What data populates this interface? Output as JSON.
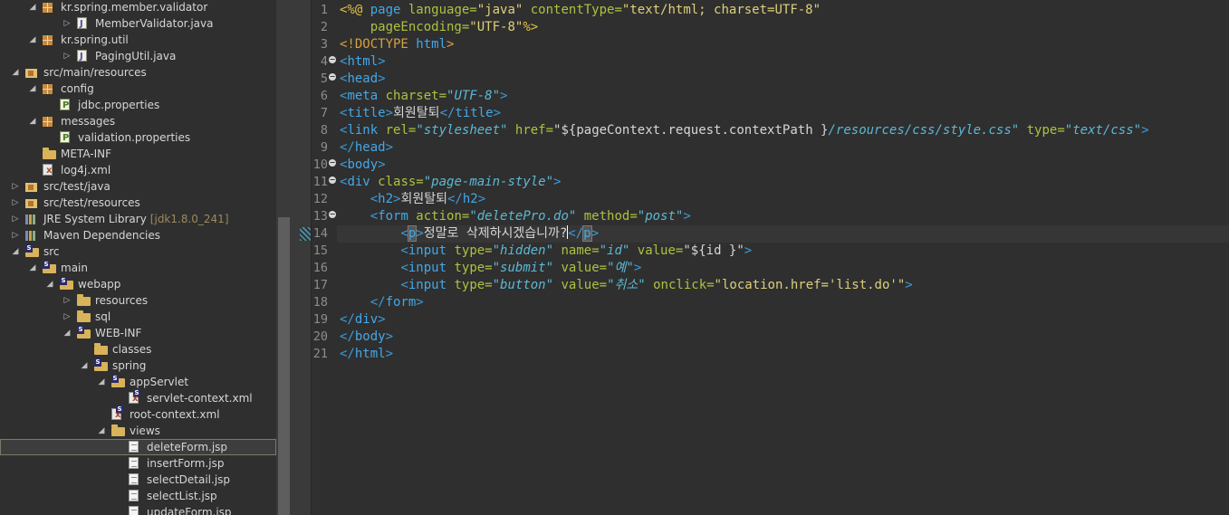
{
  "explorer": {
    "items": [
      {
        "label": "kr.spring.member.validator",
        "icon": "package-icon",
        "twisty": "open"
      },
      {
        "label": "MemberValidator.java",
        "icon": "java-file-icon",
        "twisty": "closed"
      },
      {
        "label": "kr.spring.util",
        "icon": "package-icon",
        "twisty": "open"
      },
      {
        "label": "PagingUtil.java",
        "icon": "java-file-icon",
        "twisty": "closed"
      },
      {
        "label": "src/main/resources",
        "icon": "source-folder-icon",
        "twisty": "open"
      },
      {
        "label": "config",
        "icon": "package-icon",
        "twisty": "open"
      },
      {
        "label": "jdbc.properties",
        "icon": "properties-file-icon",
        "twisty": ""
      },
      {
        "label": "messages",
        "icon": "package-icon",
        "twisty": "open"
      },
      {
        "label": "validation.properties",
        "icon": "properties-file-icon",
        "twisty": ""
      },
      {
        "label": "META-INF",
        "icon": "folder-icon",
        "twisty": ""
      },
      {
        "label": "log4j.xml",
        "icon": "xml-file-icon",
        "twisty": ""
      },
      {
        "label": "src/test/java",
        "icon": "source-folder-icon",
        "twisty": "closed"
      },
      {
        "label": "src/test/resources",
        "icon": "source-folder-icon",
        "twisty": "closed"
      },
      {
        "label": "JRE System Library",
        "decor": "[jdk1.8.0_241]",
        "icon": "library-icon",
        "twisty": "closed"
      },
      {
        "label": "Maven Dependencies",
        "icon": "library-icon",
        "twisty": "closed"
      },
      {
        "label": "src",
        "icon": "folder-icon",
        "twisty": "open"
      },
      {
        "label": "main",
        "icon": "folder-icon",
        "twisty": "open"
      },
      {
        "label": "webapp",
        "icon": "folder-icon",
        "twisty": "open"
      },
      {
        "label": "resources",
        "icon": "folder-icon",
        "twisty": "closed"
      },
      {
        "label": "sql",
        "icon": "folder-icon",
        "twisty": "closed"
      },
      {
        "label": "WEB-INF",
        "icon": "folder-icon",
        "twisty": "open"
      },
      {
        "label": "classes",
        "icon": "folder-icon",
        "twisty": ""
      },
      {
        "label": "spring",
        "icon": "folder-icon",
        "twisty": "open"
      },
      {
        "label": "appServlet",
        "icon": "folder-icon",
        "twisty": "open"
      },
      {
        "label": "servlet-context.xml",
        "icon": "spring-xml-icon",
        "twisty": ""
      },
      {
        "label": "root-context.xml",
        "icon": "spring-xml-icon",
        "twisty": ""
      },
      {
        "label": "views",
        "icon": "folder-icon",
        "twisty": "open"
      },
      {
        "label": "deleteForm.jsp",
        "icon": "jsp-file-icon",
        "twisty": "",
        "selected": true
      },
      {
        "label": "insertForm.jsp",
        "icon": "jsp-file-icon",
        "twisty": ""
      },
      {
        "label": "selectDetail.jsp",
        "icon": "jsp-file-icon",
        "twisty": ""
      },
      {
        "label": "selectList.jsp",
        "icon": "jsp-file-icon",
        "twisty": ""
      },
      {
        "label": "updateForm.jsp",
        "icon": "jsp-file-icon",
        "twisty": ""
      }
    ]
  },
  "editor": {
    "line_numbers": [
      "1",
      "2",
      "3",
      "4",
      "5",
      "6",
      "7",
      "8",
      "9",
      "10",
      "11",
      "12",
      "13",
      "14",
      "15",
      "16",
      "17",
      "18",
      "19",
      "20",
      "21"
    ],
    "current_line": "14",
    "fold_lines": [
      "4",
      "5",
      "10",
      "11",
      "13"
    ],
    "lines": {
      "l1": {
        "a": "<%@ ",
        "b": "page",
        "c": " language=",
        "d": "\"java\"",
        "e": " contentType=",
        "f": "\"text/html; charset=UTF-8\""
      },
      "l2": {
        "a": "pageEncoding=",
        "b": "\"UTF-8\"",
        "c": "%>"
      },
      "l3": {
        "a": "<!DOCTYPE ",
        "b": "html",
        "c": ">"
      },
      "l4": {
        "a": "<",
        "b": "html",
        "c": ">"
      },
      "l5": {
        "a": "<",
        "b": "head",
        "c": ">"
      },
      "l6": {
        "a": "<",
        "b": "meta",
        "c": " charset=",
        "d": "\"UTF-8\"",
        "e": ">"
      },
      "l7": {
        "a": "<",
        "b": "title",
        "c": ">",
        "d": "회원탈퇴",
        "e": "</",
        "f": "title",
        "g": ">"
      },
      "l8": {
        "a": "<",
        "b": "link",
        "c": " rel=",
        "d": "\"stylesheet\"",
        "e": " href=",
        "f": "\"${pageContext.request.contextPath }",
        "g": "/resources/css/style.css\"",
        "h": " type=",
        "i": "\"text/css\"",
        "j": ">"
      },
      "l9": {
        "a": "</",
        "b": "head",
        "c": ">"
      },
      "l10": {
        "a": "<",
        "b": "body",
        "c": ">"
      },
      "l11": {
        "a": "<",
        "b": "div",
        "c": " class=",
        "d": "\"page-main-style\"",
        "e": ">"
      },
      "l12": {
        "a": "<",
        "b": "h2",
        "c": ">",
        "d": "회원탈퇴",
        "e": "</",
        "f": "h2",
        "g": ">"
      },
      "l13": {
        "a": "<",
        "b": "form",
        "c": " action=",
        "d": "\"deletePro.do\"",
        "e": " method=",
        "f": "\"post\"",
        "g": ">"
      },
      "l14": {
        "a": "<",
        "b": "p",
        "c": ">",
        "d": "정말로 삭제하시겠습니까?",
        "e": "</",
        "f": "p",
        "g": ">"
      },
      "l15": {
        "a": "<",
        "b": "input",
        "c": " type=",
        "d": "\"hidden\"",
        "e": " name=",
        "f": "\"id\"",
        "g": " value=",
        "h": "\"${id }\"",
        "i": ">"
      },
      "l16": {
        "a": "<",
        "b": "input",
        "c": " type=",
        "d": "\"submit\"",
        "e": " value=",
        "f": "\"예\"",
        "g": ">"
      },
      "l17": {
        "a": "<",
        "b": "input",
        "c": " type=",
        "d": "\"button\"",
        "e": " value=",
        "f": "\"취소\"",
        "g": " onclick=",
        "h": "\"location.href='list.do'\"",
        "i": ">"
      },
      "l18": {
        "a": "</",
        "b": "form",
        "c": ">"
      },
      "l19": {
        "a": "</",
        "b": "div",
        "c": ">"
      },
      "l20": {
        "a": "</",
        "b": "body",
        "c": ">"
      },
      "l21": {
        "a": "</",
        "b": "html",
        "c": ">"
      }
    }
  }
}
